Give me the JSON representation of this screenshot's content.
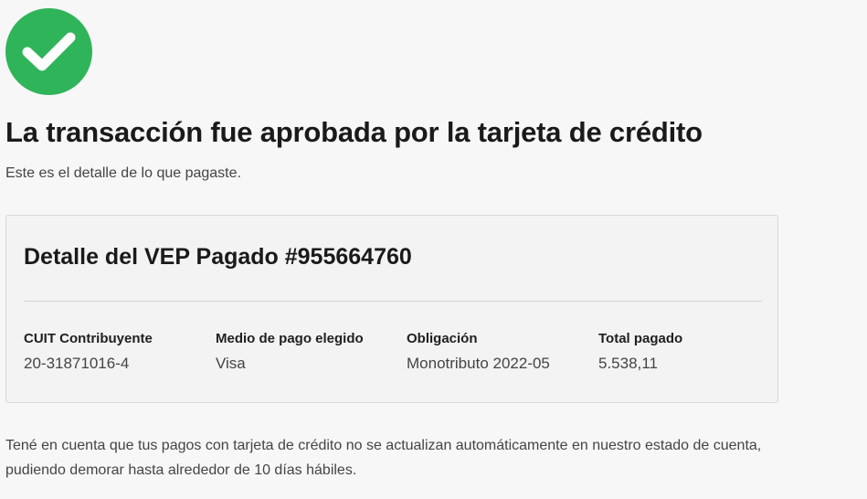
{
  "status": {
    "icon": "check-circle-icon",
    "color": "#2fb45a"
  },
  "title": "La transacción fue aprobada por la tarjeta de crédito",
  "subtitle": "Este es el detalle de lo que pagaste.",
  "card": {
    "title": "Detalle del VEP Pagado #955664760",
    "fields": [
      {
        "label": "CUIT Contribuyente",
        "value": "20-31871016-4"
      },
      {
        "label": "Medio de pago elegido",
        "value": "Visa"
      },
      {
        "label": "Obligación",
        "value": "Monotributo 2022-05"
      },
      {
        "label": "Total pagado",
        "value": "5.538,11"
      }
    ]
  },
  "note": "Tené en cuenta que tus pagos con tarjeta de crédito no se actualizan automáticamente en nuestro estado de cuenta, pudiendo demorar hasta alrededor de 10 días hábiles."
}
